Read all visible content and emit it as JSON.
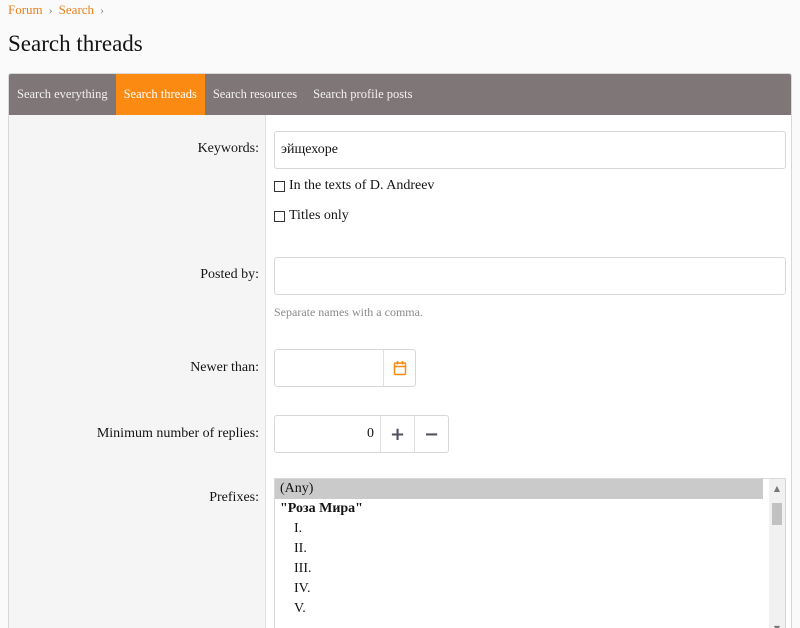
{
  "breadcrumb": {
    "items": [
      "Forum",
      "Search"
    ],
    "separator": "›"
  },
  "page_title": "Search threads",
  "tabs": [
    {
      "label": "Search everything",
      "active": false
    },
    {
      "label": "Search threads",
      "active": true
    },
    {
      "label": "Search resources",
      "active": false
    },
    {
      "label": "Search profile posts",
      "active": false
    }
  ],
  "form": {
    "keywords": {
      "label": "Keywords:",
      "value": "эйщехоре"
    },
    "checkbox_texts": {
      "label": "In the texts of D. Andreev",
      "checked": false
    },
    "checkbox_titles": {
      "label": "Titles only",
      "checked": false
    },
    "posted_by": {
      "label": "Posted by:",
      "value": "",
      "hint": "Separate names with a comma."
    },
    "newer_than": {
      "label": "Newer than:",
      "value": "",
      "icon": "calendar-icon"
    },
    "min_replies": {
      "label": "Minimum number of replies:",
      "value": "0",
      "plus": "+",
      "minus": "−"
    },
    "prefixes": {
      "label": "Prefixes:",
      "options": [
        {
          "text": "(Any)",
          "kind": "selected"
        },
        {
          "text": "\"Роза Мира\"",
          "kind": "group"
        },
        {
          "text": "I.",
          "kind": "child"
        },
        {
          "text": "II.",
          "kind": "child"
        },
        {
          "text": "III.",
          "kind": "child"
        },
        {
          "text": "IV.",
          "kind": "child"
        },
        {
          "text": "V.",
          "kind": "child"
        }
      ]
    }
  },
  "colors": {
    "accent": "#fa8a12",
    "tab_bar": "#7f7777",
    "link": "#e8811b"
  }
}
